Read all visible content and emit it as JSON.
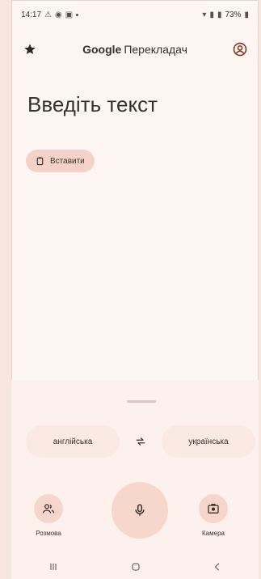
{
  "status_bar": {
    "time": "14:17",
    "right_text": "73%"
  },
  "header": {
    "brand": "Google",
    "app_name": "Перекладач"
  },
  "input": {
    "placeholder": "Введіть текст"
  },
  "paste": {
    "label": "Вставити"
  },
  "languages": {
    "source": "англійська",
    "target": "українська"
  },
  "actions": {
    "conversation_label": "Розмова",
    "camera_label": "Камера"
  },
  "colors": {
    "accent": "#f7d7cc",
    "background": "#fdf6f3",
    "panel": "#fdf1ed"
  },
  "icons": [
    "star-icon",
    "account-icon",
    "clipboard-icon",
    "swap-icon",
    "people-icon",
    "mic-icon",
    "camera-icon",
    "recents-icon",
    "home-icon",
    "back-icon"
  ]
}
